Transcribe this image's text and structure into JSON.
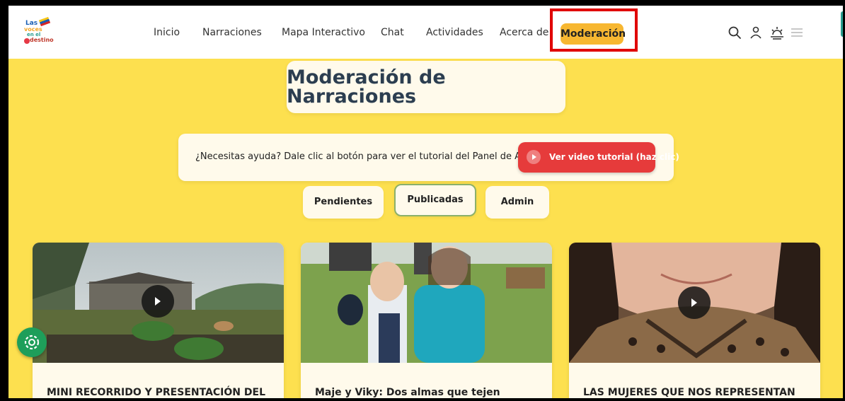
{
  "logo": {
    "line1": "Las",
    "line2": "voces",
    "line3": "en el",
    "line4": "destino"
  },
  "nav": {
    "items": [
      "Inicio",
      "Narraciones",
      "Mapa Interactivo",
      "Chat",
      "Actividades",
      "Acerca de"
    ],
    "active": "Moderación"
  },
  "page": {
    "title": "Moderación de Narraciones"
  },
  "help": {
    "text": "¿Necesitas ayuda? Dale clic al botón para ver el tutorial del Panel de Admin.",
    "button": "Ver video tutorial (haz clic)"
  },
  "tabs": [
    "Pendientes",
    "Publicadas",
    "Admin"
  ],
  "cards": [
    {
      "title": "MINI RECORRIDO Y PRESENTACIÓN DEL"
    },
    {
      "title": "Maje y Viky: Dos almas que tejen"
    },
    {
      "title": "LAS MUJERES QUE NOS REPRESENTAN"
    }
  ],
  "colors": {
    "accent": "#f7b731",
    "brand_red": "#e63b3b",
    "bg_yellow": "#fde04f",
    "fab_green": "#1e9e5a"
  },
  "icons": [
    "search-icon",
    "user-icon",
    "sun-icon",
    "menu-icon",
    "play-icon",
    "gear-icon"
  ]
}
